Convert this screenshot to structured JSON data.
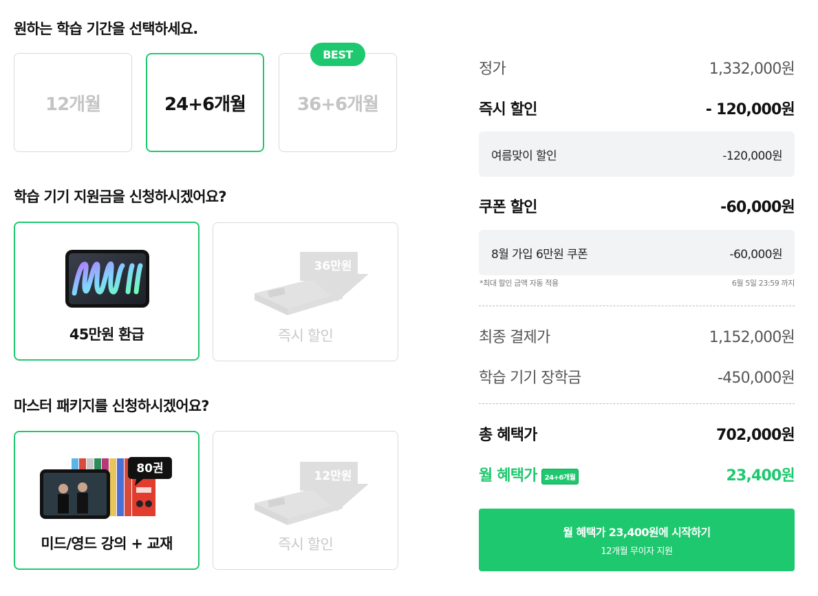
{
  "period": {
    "title": "원하는 학습 기간을 선택하세요.",
    "options": [
      {
        "label": "12개월",
        "selected": false
      },
      {
        "label": "24+6개월",
        "selected": true
      },
      {
        "label": "36+6개월",
        "selected": false
      }
    ],
    "best_badge": "BEST"
  },
  "device": {
    "title": "학습 기기 지원금을 신청하시겠어요?",
    "options": [
      {
        "label": "45만원 환급",
        "selected": true,
        "image": "ipad-mini-illustration"
      },
      {
        "label": "즉시 할인",
        "selected": false,
        "image": "box-with-price-tag",
        "tag": "36만원"
      }
    ]
  },
  "package": {
    "title": "마스터 패키지를 신청하시겠어요?",
    "options": [
      {
        "label": "미드/영드 강의 + 교재",
        "selected": true,
        "image": "tablet-and-books",
        "bubble": "80권"
      },
      {
        "label": "즉시 할인",
        "selected": false,
        "image": "box-with-price-tag",
        "tag": "12만원"
      }
    ]
  },
  "summary": {
    "list_price": {
      "label": "정가",
      "value": "1,332,000원"
    },
    "instant_discount": {
      "label": "즉시 할인",
      "value": "- 120,000원"
    },
    "instant_detail": {
      "label": "여름맞이 할인",
      "value": "-120,000원"
    },
    "coupon_discount": {
      "label": "쿠폰 할인",
      "value": "-60,000원"
    },
    "coupon_detail": {
      "label": "8월 가입 6만원 쿠폰",
      "value": "-60,000원"
    },
    "note_left": "*최대 할인 금액 자동 적용",
    "note_right": "6월 5일 23:59 까지",
    "final_price": {
      "label": "최종 결제가",
      "value": "1,152,000원"
    },
    "scholarship": {
      "label": "학습 기기 장학금",
      "value": "-450,000원"
    },
    "total_benefit": {
      "label": "총 혜택가",
      "value": "702,000원"
    },
    "monthly": {
      "label": "월 혜택가",
      "badge": "24+6개월",
      "value": "23,400원"
    }
  },
  "cta": {
    "line1": "월 혜택가 23,400원에 시작하기",
    "line2": "12개월 무이자 지원"
  },
  "colors": {
    "accent": "#1ec86e",
    "border": "#d9d9d9",
    "subbox": "#f2f3f5"
  }
}
